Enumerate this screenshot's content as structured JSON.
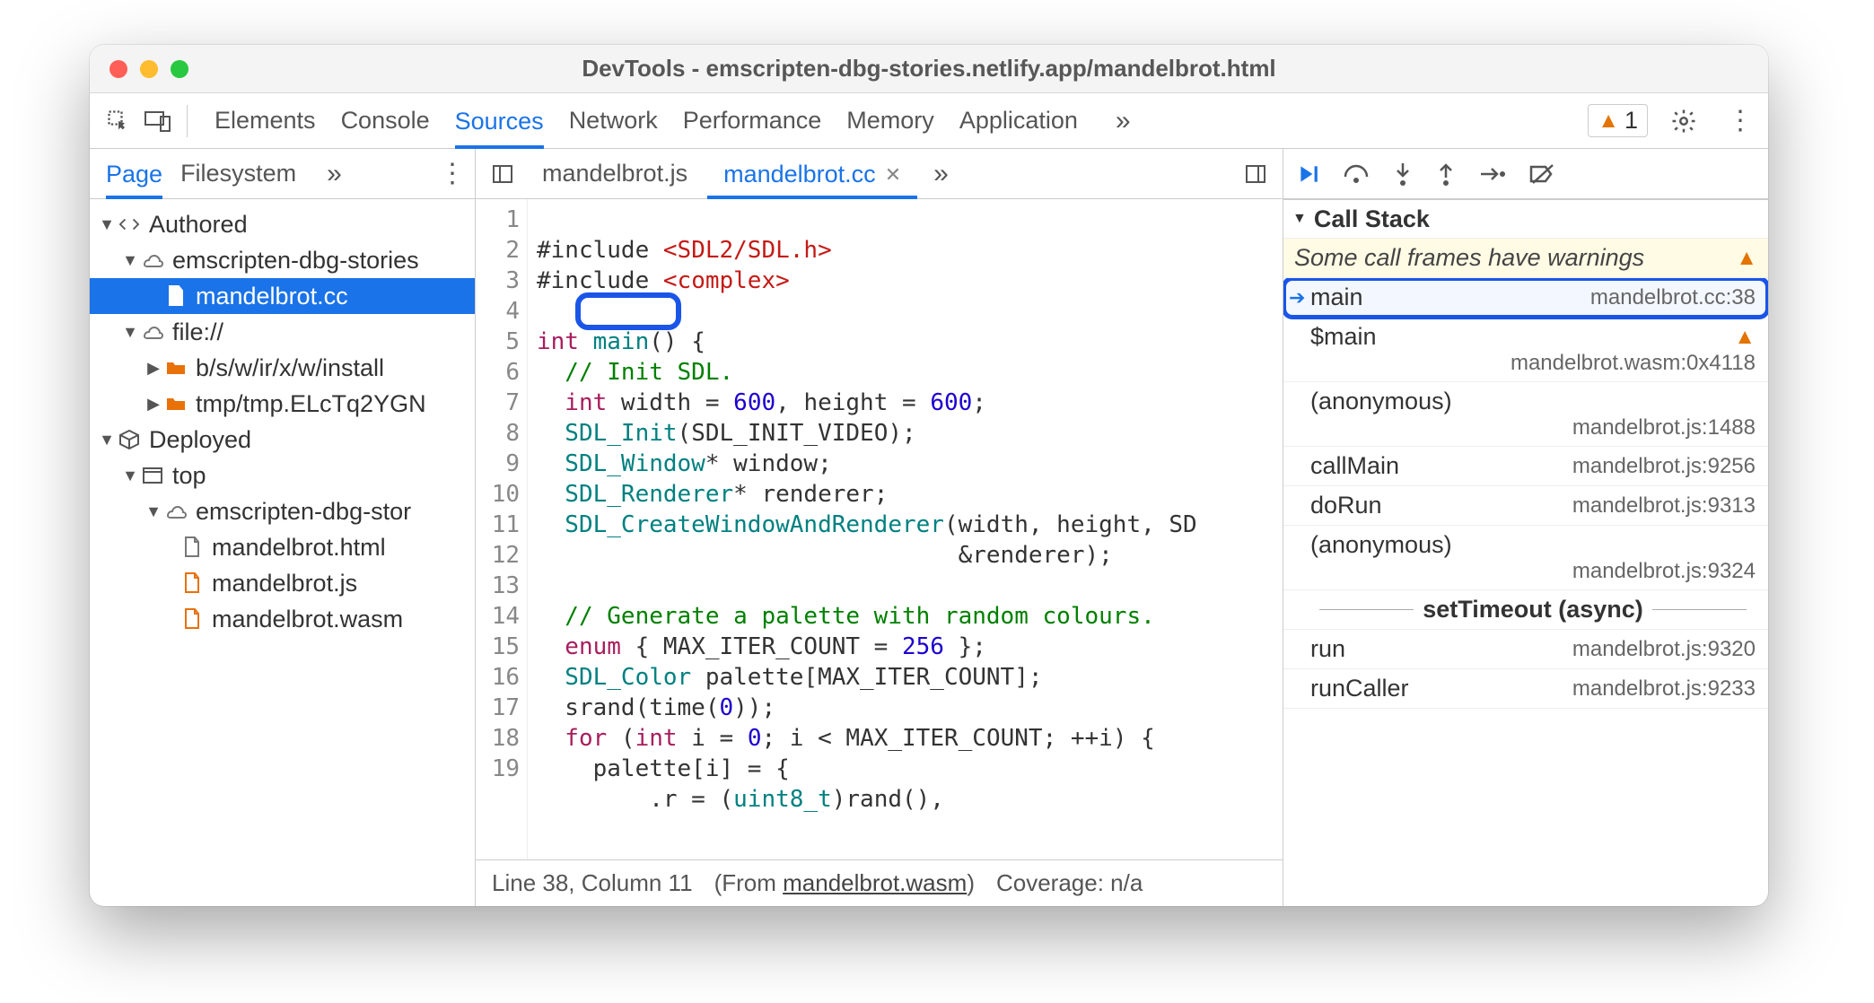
{
  "window_title": "DevTools - emscripten-dbg-stories.netlify.app/mandelbrot.html",
  "main_tabs": [
    "Elements",
    "Console",
    "Sources",
    "Network",
    "Performance",
    "Memory",
    "Application"
  ],
  "main_tabs_active": 2,
  "warning_count": "1",
  "nav_tabs": [
    "Page",
    "Filesystem"
  ],
  "nav_tabs_active": 0,
  "tree": {
    "authored": "Authored",
    "site": "emscripten-dbg-stories",
    "selected_file": "mandelbrot.cc",
    "filescheme": "file://",
    "folder1": "b/s/w/ir/x/w/install",
    "folder2": "tmp/tmp.ELcTq2YGN",
    "deployed": "Deployed",
    "top": "top",
    "site2": "emscripten-dbg-stor",
    "html": "mandelbrot.html",
    "js": "mandelbrot.js",
    "wasm": "mandelbrot.wasm"
  },
  "editor_tabs": [
    "mandelbrot.js",
    "mandelbrot.cc"
  ],
  "editor_active": 1,
  "code": {
    "l1a": "#include ",
    "l1b": "<SDL2/SDL.h>",
    "l2a": "#include ",
    "l2b": "<complex>",
    "l4a": "int",
    "l4b": " main",
    "l4c": "() {",
    "l5": "  // Init SDL.",
    "l6a": "  int",
    "l6b": " width = ",
    "l6c": "600",
    "l6d": ", height = ",
    "l6e": "600",
    "l6f": ";",
    "l7a": "  SDL_Init",
    "l7b": "(SDL_INIT_VIDEO);",
    "l8a": "  SDL_Window",
    "l8b": "* window;",
    "l9a": "  SDL_Renderer",
    "l9b": "* renderer;",
    "l10a": "  SDL_CreateWindowAndRenderer",
    "l10b": "(width, height, SD",
    "l11": "                              &renderer);",
    "l13": "  // Generate a palette with random colours.",
    "l14a": "  enum",
    "l14b": " { MAX_ITER_COUNT = ",
    "l14c": "256",
    "l14d": " };",
    "l15a": "  SDL_Color",
    "l15b": " palette[MAX_ITER_COUNT];",
    "l16a": "  srand(time(",
    "l16b": "0",
    "l16c": "));",
    "l17a": "  for",
    "l17b": " (",
    "l17c": "int",
    "l17d": " i = ",
    "l17e": "0",
    "l17f": "; i < MAX_ITER_COUNT; ++i) {",
    "l18": "    palette[i] = {",
    "l19a": "        .r = (",
    "l19b": "uint8_t",
    "l19c": ")rand(),"
  },
  "status": {
    "pos": "Line 38, Column 11",
    "from_label": "(From ",
    "from_file": "mandelbrot.wasm",
    "from_close": ")",
    "coverage": "Coverage: n/a"
  },
  "callstack_label": "Call Stack",
  "callstack_warning": "Some call frames have warnings",
  "frames": [
    {
      "name": "main",
      "loc": "mandelbrot.cc:38",
      "current": true
    },
    {
      "name": "$main",
      "loc": "mandelbrot.wasm:0x4118",
      "warn": true
    },
    {
      "name": "(anonymous)",
      "loc": "mandelbrot.js:1488"
    },
    {
      "name": "callMain",
      "loc": "mandelbrot.js:9256"
    },
    {
      "name": "doRun",
      "loc": "mandelbrot.js:9313"
    },
    {
      "name": "(anonymous)",
      "loc": "mandelbrot.js:9324"
    },
    {
      "name": "setTimeout (async)",
      "async": true
    },
    {
      "name": "run",
      "loc": "mandelbrot.js:9320"
    },
    {
      "name": "runCaller",
      "loc": "mandelbrot.js:9233"
    }
  ]
}
